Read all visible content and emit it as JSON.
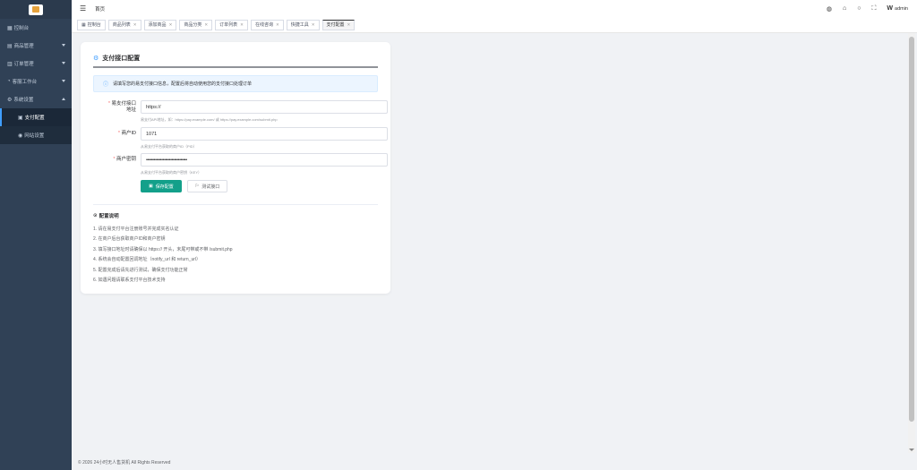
{
  "sidebar": {
    "items": [
      {
        "label": "控制台",
        "icon": "dashboard-icon"
      },
      {
        "label": "商品管理",
        "icon": "goods-icon"
      },
      {
        "label": "订单管理",
        "icon": "order-icon"
      },
      {
        "label": "客服工作台",
        "icon": "service-icon"
      },
      {
        "label": "系统设置",
        "icon": "gear-icon"
      }
    ],
    "sub_items": [
      {
        "label": "支付配置",
        "icon": "payment-icon",
        "active": true
      },
      {
        "label": "网站设置",
        "icon": "site-icon",
        "active": false
      }
    ]
  },
  "header": {
    "breadcrumb": "首页",
    "user": "admin"
  },
  "tabs": [
    {
      "label": "控制台",
      "closable": false,
      "active": false
    },
    {
      "label": "商品列表",
      "closable": true,
      "active": false
    },
    {
      "label": "添加商品",
      "closable": true,
      "active": false
    },
    {
      "label": "商品分类",
      "closable": true,
      "active": false
    },
    {
      "label": "订单列表",
      "closable": true,
      "active": false
    },
    {
      "label": "在线咨询",
      "closable": true,
      "active": false
    },
    {
      "label": "快捷工具",
      "closable": true,
      "active": false
    },
    {
      "label": "支付配置",
      "closable": true,
      "active": true
    }
  ],
  "card": {
    "title": "支付接口配置",
    "alert": "请填写您的易支付接口信息，配置后将自动使用您的支付接口处理订单",
    "fields": {
      "api_url": {
        "label_line1": "易支付接口",
        "label_line2": "地址",
        "value": "https://",
        "hint": "易支付API地址，如：https://pay.example.com/ 或 https://pay.example.com/submit.php"
      },
      "merchant_id": {
        "label": "商户ID",
        "value": "1071",
        "hint": "从易支付平台获取的商户ID（PID）"
      },
      "merchant_key": {
        "label": "商户密钥",
        "value": "••••••••••••••••••••••••••••••••",
        "hint": "从易支付平台获取的商户密钥（KEY）"
      }
    },
    "save_button": "保存配置",
    "test_button": "测试接口",
    "help_title": "配置说明",
    "help_items": [
      "1. 请在易支付平台注册账号并完成实名认证",
      "2. 在商户后台获取商户ID和商户密钥",
      "3. 填写接口地址时请确保以 https:// 开头，末尾可带或不带 /submit.php",
      "4. 系统会自动配置回调地址（notify_url 和 return_url）",
      "5. 配置完成后请先进行测试，确保支付功能正常",
      "6. 如遇问题请联系支付平台技术支持"
    ]
  },
  "footer": "© 2026 24小时无人售货机 All Rights Reserved",
  "colors": {
    "sidebar_bg": "#304156",
    "primary": "#13a08a",
    "accent": "#409eff"
  }
}
